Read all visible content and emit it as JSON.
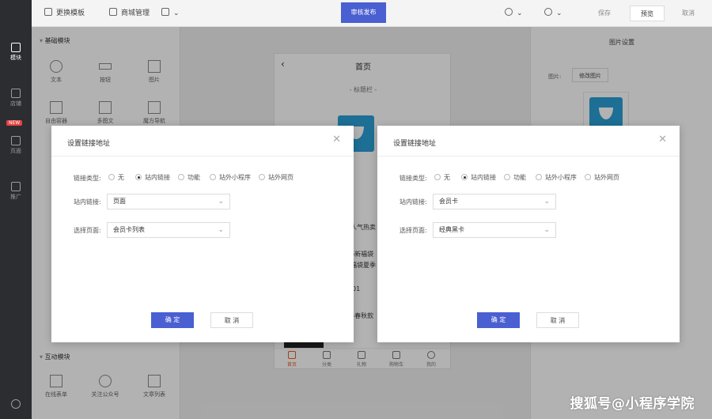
{
  "rail": {
    "items": [
      {
        "label": "模块",
        "icon": "module-icon"
      },
      {
        "label": "店铺",
        "icon": "store-icon"
      },
      {
        "label": "页面",
        "icon": "page-icon"
      },
      {
        "label": "推广",
        "icon": "promote-icon"
      }
    ],
    "new_badge": "NEW"
  },
  "topbar": {
    "skin_label": "更换模板",
    "mall_label": "商城管理",
    "publish_label": "审核发布",
    "save_label": "保存",
    "preview_label": "预览",
    "cancel_label": "取消"
  },
  "sidebar": {
    "basic_title": "基础模块",
    "basic_items": [
      {
        "label": "文本",
        "icon": "text-icon"
      },
      {
        "label": "按钮",
        "icon": "button-icon"
      },
      {
        "label": "图片",
        "icon": "image-icon"
      },
      {
        "label": "自由容器",
        "icon": "container-icon"
      },
      {
        "label": "多图文",
        "icon": "multi-image-icon"
      },
      {
        "label": "魔方导航",
        "icon": "grid-nav-icon"
      }
    ],
    "interact_title": "互动模块",
    "interact_items": [
      {
        "label": "在线表单",
        "icon": "form-icon"
      },
      {
        "label": "关注公众号",
        "icon": "follow-icon"
      },
      {
        "label": "文章列表",
        "icon": "article-list-icon"
      }
    ]
  },
  "phone": {
    "back": "‹",
    "title": "首页",
    "title_bar": "- 标题栏 -",
    "text_fragments": [
      "人气热卖",
      "6新福袋",
      "福袋夏季",
      "01",
      "5春秋款"
    ],
    "tabs": [
      "首页",
      "分类",
      "礼物",
      "购物车",
      "我的"
    ]
  },
  "right_panel": {
    "title": "图片设置",
    "image_label": "图片:",
    "modify_button": "修改图片"
  },
  "modal_left": {
    "title": "设置链接地址",
    "link_type_label": "链接类型:",
    "options": [
      "无",
      "站内链接",
      "功能",
      "站外小程序",
      "站外网页"
    ],
    "selected_index": 1,
    "internal_label": "站内链接:",
    "internal_value": "页面",
    "page_label": "选择页面:",
    "page_value": "会员卡列表",
    "ok": "确 定",
    "cancel": "取 消"
  },
  "modal_right": {
    "title": "设置链接地址",
    "link_type_label": "链接类型:",
    "options": [
      "无",
      "站内链接",
      "功能",
      "站外小程序",
      "站外网页"
    ],
    "selected_index": 1,
    "internal_label": "站内链接:",
    "internal_value": "会员卡",
    "page_label": "选择页面:",
    "page_value": "经典黑卡",
    "ok": "确 定",
    "cancel": "取 消"
  },
  "watermark": "搜狐号@小程序学院",
  "colors": {
    "accent": "#4a5fd1",
    "rail": "#2b2d31",
    "logo": "#2a9fd6",
    "badge": "#e64340"
  }
}
